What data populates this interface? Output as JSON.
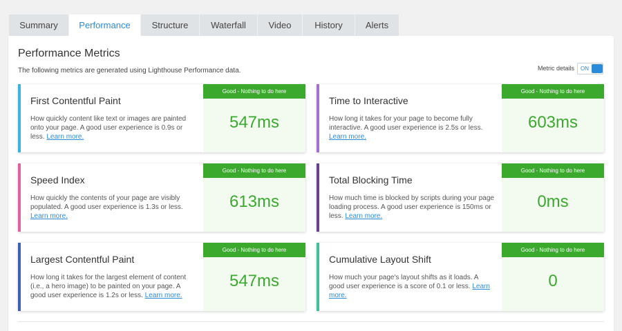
{
  "tabs": [
    {
      "label": "Summary",
      "active": false
    },
    {
      "label": "Performance",
      "active": true
    },
    {
      "label": "Structure",
      "active": false
    },
    {
      "label": "Waterfall",
      "active": false
    },
    {
      "label": "Video",
      "active": false
    },
    {
      "label": "History",
      "active": false
    },
    {
      "label": "Alerts",
      "active": false
    }
  ],
  "panel": {
    "title": "Performance Metrics",
    "subtitle": "The following metrics are generated using Lighthouse Performance data.",
    "metric_details_label": "Metric details",
    "toggle_state": "ON"
  },
  "metrics": [
    {
      "title": "First Contentful Paint",
      "description": "How quickly content like text or images are painted onto your page. A good user experience is 0.9s or less.",
      "link": "Learn more.",
      "badge": "Good - Nothing to do here",
      "value": "547ms",
      "accent": "#3bb3df"
    },
    {
      "title": "Time to Interactive",
      "description": "How long it takes for your page to become fully interactive. A good user experience is 2.5s or less.",
      "link": "Learn more.",
      "badge": "Good - Nothing to do here",
      "value": "603ms",
      "accent": "#a56fce"
    },
    {
      "title": "Speed Index",
      "description": "How quickly the contents of your page are visibly populated. A good user experience is 1.3s or less.",
      "link": "Learn more.",
      "badge": "Good - Nothing to do here",
      "value": "613ms",
      "accent": "#e0619c"
    },
    {
      "title": "Total Blocking Time",
      "description": "How much time is blocked by scripts during your page loading process. A good user experience is 150ms or less.",
      "link": "Learn more.",
      "badge": "Good - Nothing to do here",
      "value": "0ms",
      "accent": "#6a3f8f"
    },
    {
      "title": "Largest Contentful Paint",
      "description": "How long it takes for the largest element of content (i.e., a hero image) to be painted on your page. A good user experience is 1.2s or less.",
      "link": "Learn more.",
      "badge": "Good - Nothing to do here",
      "value": "547ms",
      "accent": "#3f5fb5"
    },
    {
      "title": "Cumulative Layout Shift",
      "description": "How much your page's layout shifts as it loads. A good user experience is a score of 0.1 or less.",
      "link": "Learn more.",
      "badge": "Good - Nothing to do here",
      "value": "0",
      "accent": "#3fbf9a"
    }
  ],
  "colors": {
    "good": "#3aa92d",
    "link": "#2a8bd8",
    "active_tab_text": "#2a8bd8"
  }
}
